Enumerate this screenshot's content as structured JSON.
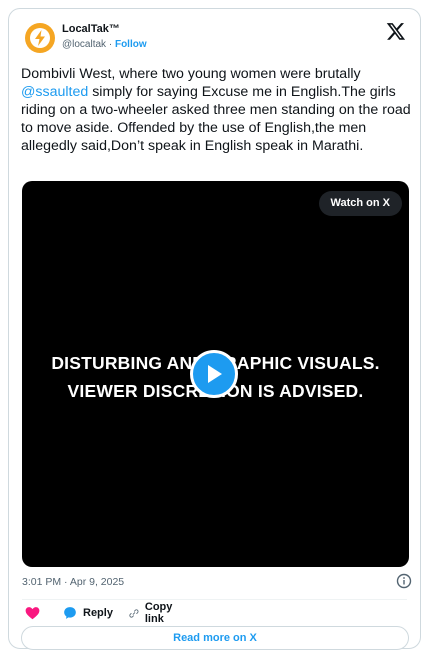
{
  "account": {
    "display_name": "LocalTak™",
    "handle": "@localtak",
    "separator": "·",
    "follow_label": "Follow"
  },
  "tweet": {
    "text_before_mention": "Dombivli West, where two young women were brutally ",
    "mention": "@ssaulted",
    "text_after_mention": " simply for saying Excuse me in English.The girls riding on a two-wheeler asked three men standing on the road to move aside. Offended by the use of English,the men allegedly said,Don’t speak in English speak in Marathi."
  },
  "video": {
    "watch_label": "Watch on X",
    "overlay_line_1": "DISTURBING AND GRAPHIC VISUALS.",
    "overlay_line_2": "VIEWER DISCRETION IS ADVISED."
  },
  "meta": {
    "timestamp": "3:01 PM · Apr 9, 2025"
  },
  "actions": {
    "reply_label": "Reply",
    "copy_link_label": "Copy link"
  },
  "read_more_label": "Read more on X",
  "colors": {
    "accent": "#1d9bf0",
    "like": "#f91880",
    "text": "#0f1419",
    "muted": "#536471",
    "border": "#cfd9de"
  },
  "icons": [
    "avatar-logo",
    "x-logo-icon",
    "play-icon",
    "info-icon",
    "heart-icon",
    "reply-bubble-icon",
    "link-icon"
  ]
}
